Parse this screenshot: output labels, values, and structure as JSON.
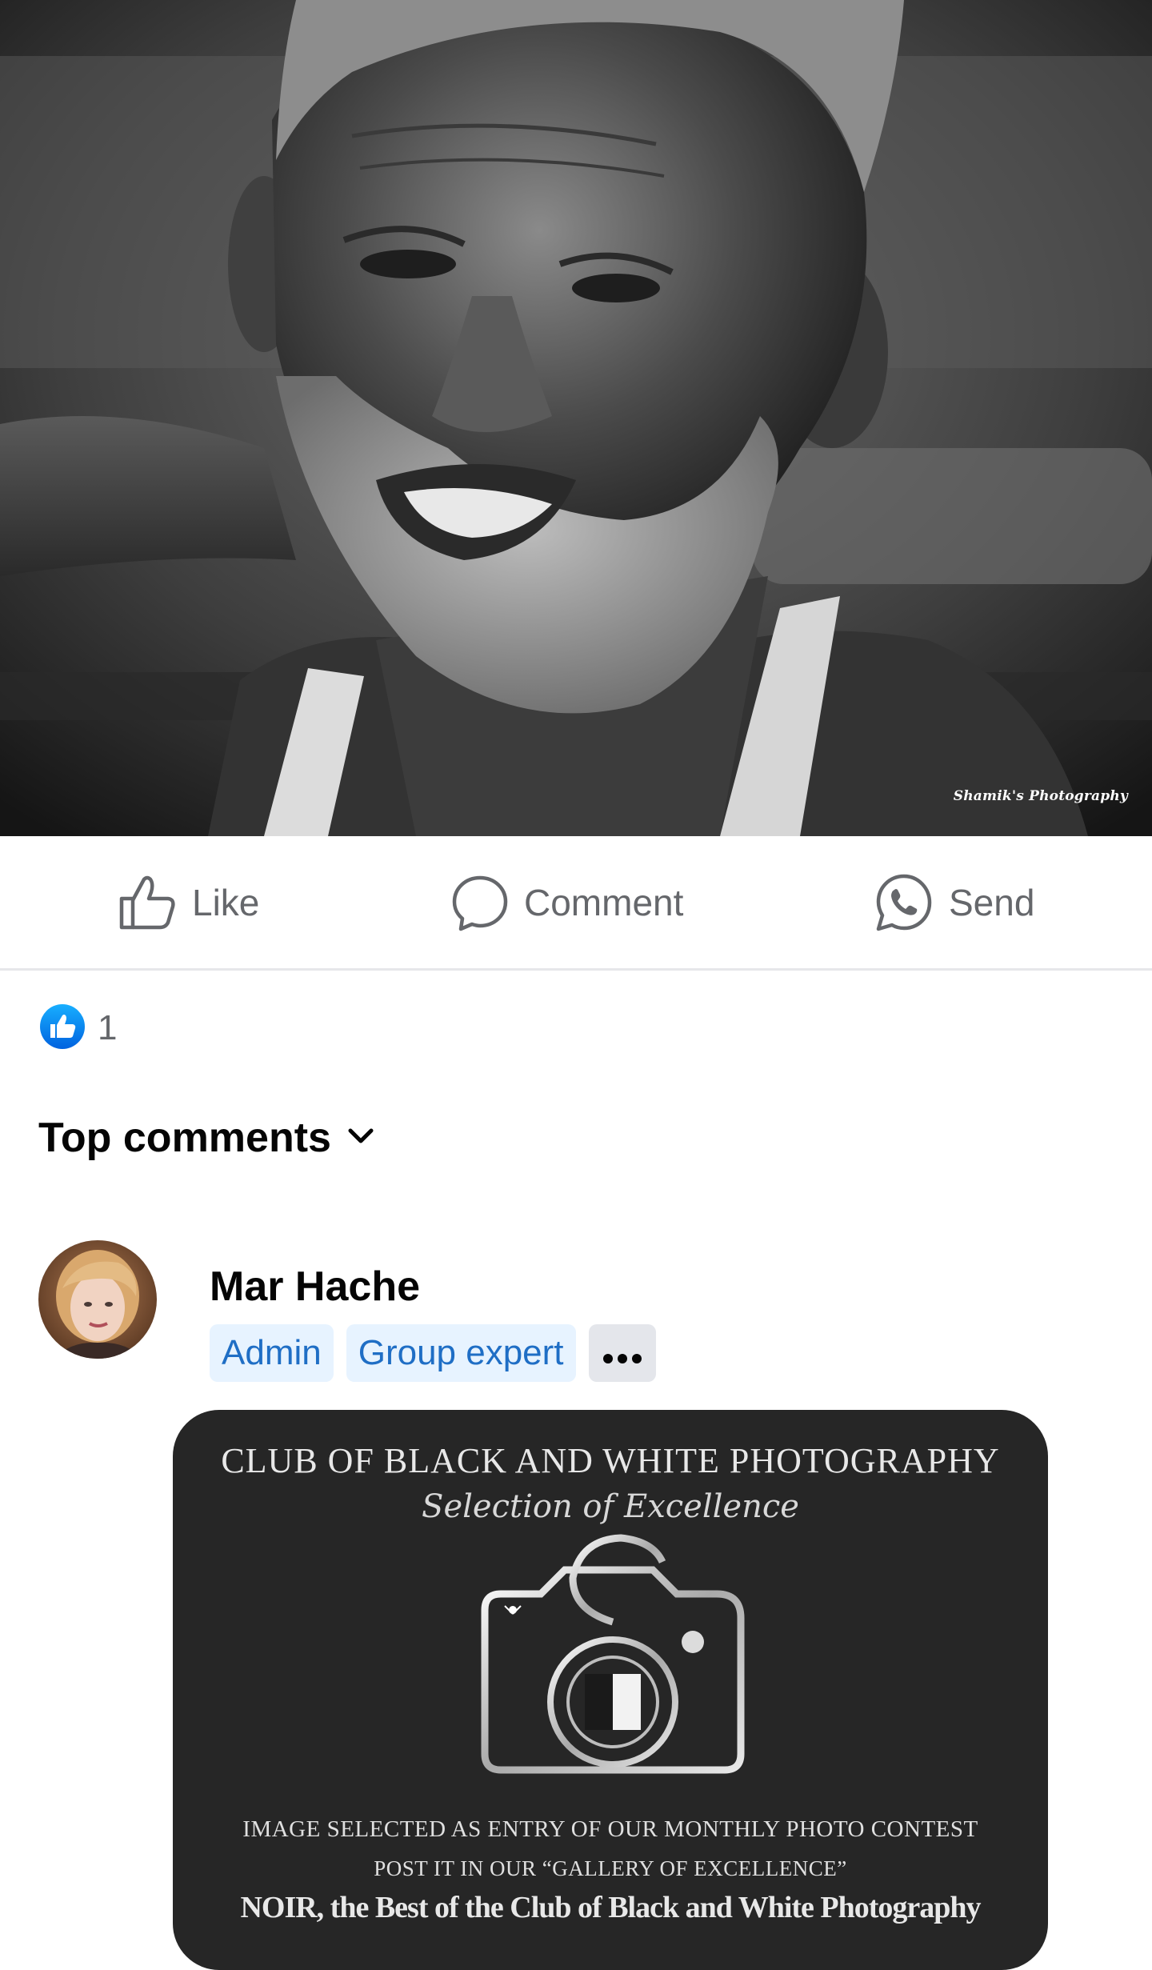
{
  "photo": {
    "watermark": "Shamik's Photography"
  },
  "actions": {
    "like_label": "Like",
    "comment_label": "Comment",
    "send_label": "Send"
  },
  "reactions": {
    "count": "1"
  },
  "comments_header": {
    "label": "Top comments"
  },
  "comment": {
    "author": "Mar Hache",
    "badges": [
      "Admin",
      "Group expert"
    ],
    "more_label": "•••",
    "attachment": {
      "title": "CLUB OF BLACK AND WHITE PHOTOGRAPHY",
      "subtitle": "Selection of Excellence",
      "line1": "IMAGE SELECTED AS ENTRY OF OUR MONTHLY PHOTO CONTEST",
      "line2": "POST IT IN OUR “GALLERY OF EXCELLENCE”",
      "line3": "NOIR, the Best of the Club of Black and White Photography"
    }
  },
  "colors": {
    "accent": "#1877f2",
    "badge_text": "#1f6ec5",
    "badge_bg": "#e7f3ff",
    "muted": "#65676b"
  },
  "icons": {
    "like": "thumbs-up-icon",
    "comment": "speech-bubble-icon",
    "send": "whatsapp-icon",
    "reaction": "like-reaction-icon",
    "dropdown": "chevron-down-icon"
  }
}
